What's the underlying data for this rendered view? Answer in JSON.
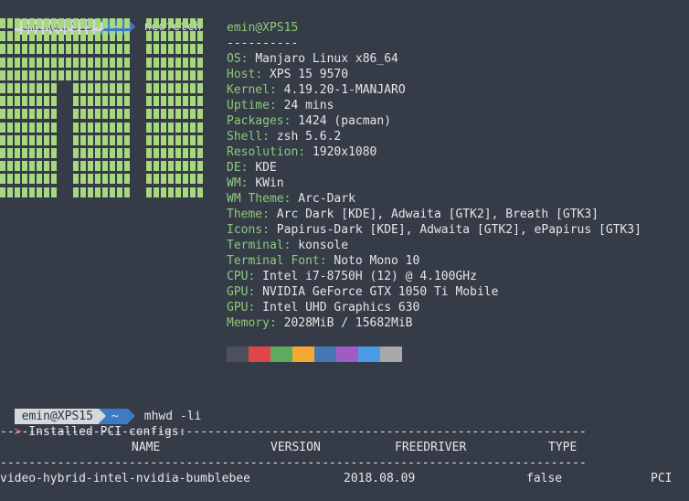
{
  "prompt1": {
    "user": "emin@XPS15",
    "dir": "~",
    "command": "neofetch"
  },
  "info": {
    "header": "emin@XPS15",
    "separator": "----------",
    "rows": [
      {
        "key": "OS",
        "value": "Manjaro Linux x86_64"
      },
      {
        "key": "Host",
        "value": "XPS 15 9570"
      },
      {
        "key": "Kernel",
        "value": "4.19.20-1-MANJARO"
      },
      {
        "key": "Uptime",
        "value": "24 mins"
      },
      {
        "key": "Packages",
        "value": "1424 (pacman)"
      },
      {
        "key": "Shell",
        "value": "zsh 5.6.2"
      },
      {
        "key": "Resolution",
        "value": "1920x1080"
      },
      {
        "key": "DE",
        "value": "KDE"
      },
      {
        "key": "WM",
        "value": "KWin"
      },
      {
        "key": "WM Theme",
        "value": "Arc-Dark"
      },
      {
        "key": "Theme",
        "value": "Arc Dark [KDE], Adwaita [GTK2], Breath [GTK3]"
      },
      {
        "key": "Icons",
        "value": "Papirus-Dark [KDE], Adwaita [GTK2], ePapirus [GTK3]"
      },
      {
        "key": "Terminal",
        "value": "konsole"
      },
      {
        "key": "Terminal Font",
        "value": "Noto Mono 10"
      },
      {
        "key": "CPU",
        "value": "Intel i7-8750H (12) @ 4.100GHz"
      },
      {
        "key": "GPU",
        "value": "NVIDIA GeForce GTX 1050 Ti Mobile"
      },
      {
        "key": "GPU",
        "value": "Intel UHD Graphics 630"
      },
      {
        "key": "Memory",
        "value": "2028MiB / 15682MiB"
      }
    ]
  },
  "swatches": [
    "#4b505c",
    "#e0454a",
    "#5fab5d",
    "#f5a832",
    "#4577b3",
    "#a05bc4",
    "#4a9ce4",
    "#a8a8a8"
  ],
  "logo_color": "#a7d77e",
  "prompt2": {
    "user": "emin@XPS15",
    "dir": "~",
    "command": "mhwd -li"
  },
  "installed": {
    "arrow": ">",
    "text": " Installed PCI configs:"
  },
  "dashes": "----------------------------------------------------------------------------------------------------------------",
  "table": {
    "headers": [
      "NAME",
      "VERSION",
      "FREEDRIVER",
      "TYPE"
    ],
    "row": [
      "video-hybrid-intel-nvidia-bumblebee",
      "2018.08.09",
      "false",
      "PCI"
    ]
  }
}
